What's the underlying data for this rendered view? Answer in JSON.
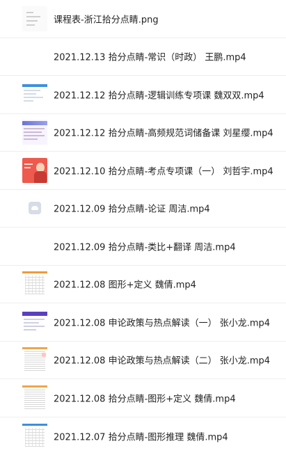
{
  "files": [
    {
      "name": "课程表-浙江拾分点睛.png",
      "thumbnail": "document-thumbnail"
    },
    {
      "name": "2021.12.13 拾分点睛-常识（时政） 王鹏.mp4",
      "thumbnail": "blank-thumbnail"
    },
    {
      "name": "2021.12.12 拾分点睛-逻辑训练专项课 魏双双.mp4",
      "thumbnail": "blue-slide-thumbnail"
    },
    {
      "name": "2021.12.12 拾分点睛-高频规范词储备课 刘星缨.mp4",
      "thumbnail": "color-slide-thumbnail"
    },
    {
      "name": "2021.12.10 拾分点睛-考点专项课（一） 刘哲宇.mp4",
      "thumbnail": "red-cover-thumbnail"
    },
    {
      "name": "2021.12.09 拾分点睛-论证 周洁.mp4",
      "thumbnail": "cloud-file-icon"
    },
    {
      "name": "2021.12.09 拾分点睛-类比+翻译 周洁.mp4",
      "thumbnail": "blank-thumbnail"
    },
    {
      "name": "2021.12.08 图形+定义 魏倩.mp4",
      "thumbnail": "worksheet-thumbnail"
    },
    {
      "name": "2021.12.08 申论政策与热点解读（一） 张小龙.mp4",
      "thumbnail": "purple-slide-thumbnail"
    },
    {
      "name": "2021.12.08 申论政策与热点解读（二） 张小龙.mp4",
      "thumbnail": "worksheet-thumbnail"
    },
    {
      "name": "2021.12.08 拾分点睛-图形+定义 魏倩.mp4",
      "thumbnail": "worksheet-thumbnail"
    },
    {
      "name": "2021.12.07 拾分点睛-图形推理 魏倩.mp4",
      "thumbnail": "worksheet-thumbnail"
    }
  ]
}
